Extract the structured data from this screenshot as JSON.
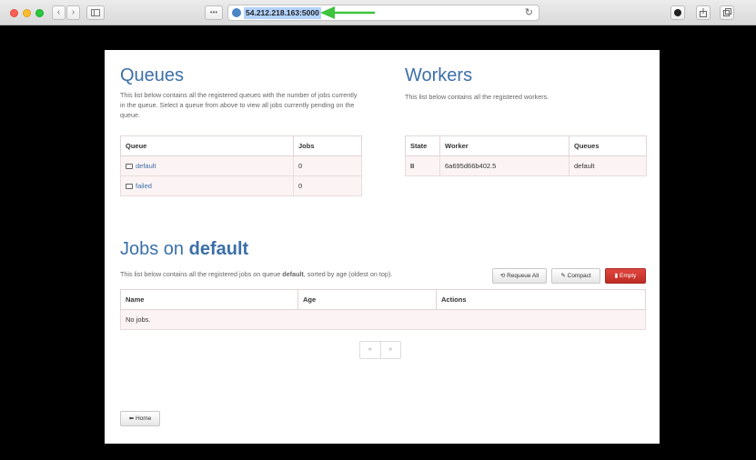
{
  "browser": {
    "dots_label": "•••",
    "url": "54.212.218.163:5000",
    "reload_icon": "reload-icon",
    "back_glyph": "‹",
    "forward_glyph": "›"
  },
  "queues": {
    "title": "Queues",
    "description": "This list below contains all the registered queues with the number of jobs currently in the queue. Select a queue from above to view all jobs currently pending on the queue.",
    "headers": [
      "Queue",
      "Jobs"
    ],
    "rows": [
      {
        "name": "default",
        "jobs": "0"
      },
      {
        "name": "failed",
        "jobs": "0"
      }
    ]
  },
  "workers": {
    "title": "Workers",
    "description": "This list below contains all the registered workers.",
    "headers": [
      "State",
      "Worker",
      "Queues"
    ],
    "rows": [
      {
        "state": "II",
        "worker": "6a695d66b402.5",
        "queues": "default"
      }
    ]
  },
  "jobs": {
    "title_prefix": "Jobs on",
    "title_queue": "default",
    "description_start": "This list below contains all the registered jobs on queue",
    "description_queue": "default",
    "description_end": ", sorted by age (oldest on top).",
    "headers": [
      "Name",
      "Age",
      "Actions"
    ],
    "empty": "No jobs.",
    "requeue_label": "Requeue All",
    "compact_label": "Compact",
    "empty_label": "Empty",
    "pager_prev": "«",
    "pager_next": "»"
  },
  "home_label": "Home",
  "colors": {
    "heading": "#3c6fa8",
    "danger": "#c9302c",
    "arrow": "#3ec43e"
  }
}
